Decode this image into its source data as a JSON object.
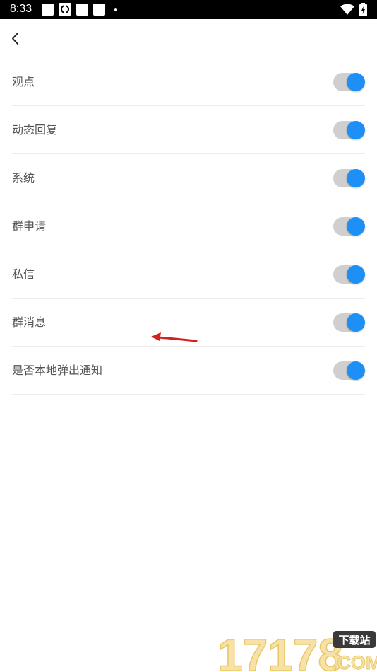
{
  "status_bar": {
    "time": "8:33"
  },
  "header": {
    "back_icon": "chevron-left-icon"
  },
  "settings": [
    {
      "label": "观点",
      "enabled": true
    },
    {
      "label": "动态回复",
      "enabled": true
    },
    {
      "label": "系统",
      "enabled": true
    },
    {
      "label": "群申请",
      "enabled": true
    },
    {
      "label": "私信",
      "enabled": true
    },
    {
      "label": "群消息",
      "enabled": true
    },
    {
      "label": "是否本地弹出通知",
      "enabled": true
    }
  ],
  "colors": {
    "toggle_on": "#1e8ff5",
    "toggle_track": "#cfcfcf",
    "label_text": "#555555",
    "divider": "#ececec",
    "annotation_arrow": "#d42020"
  },
  "watermark": {
    "brand": "17178",
    "tagline": "下载站",
    "domain": ".COM"
  }
}
